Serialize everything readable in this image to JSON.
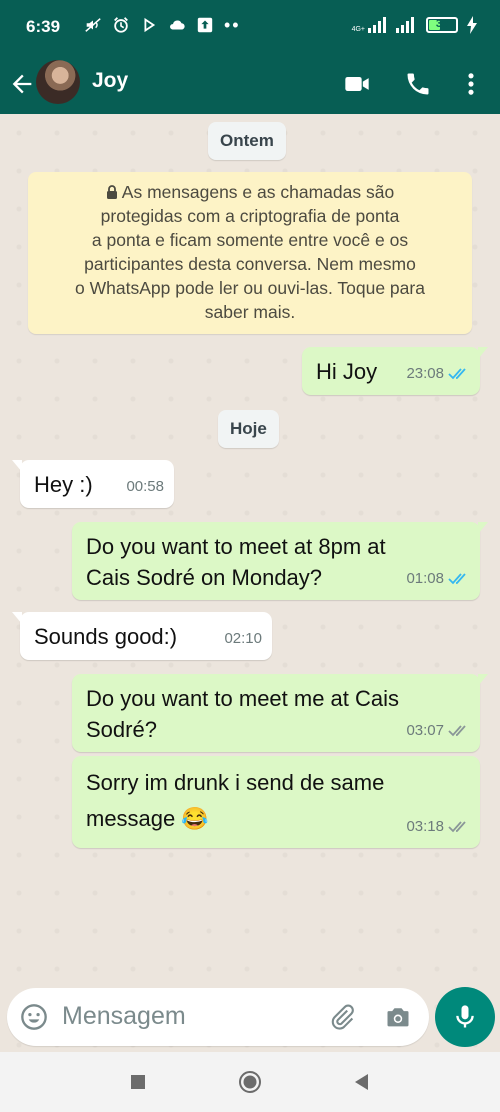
{
  "status_bar": {
    "time": "6:39",
    "battery": "39",
    "network": "4G+"
  },
  "header": {
    "contact_name": "Joy"
  },
  "chat": {
    "date_yesterday": "Ontem",
    "encryption_notice": "As mensagens e as chamadas são protegidas com a criptografia de ponta a ponta e ficam somente entre você e os participantes desta conversa. Nem mesmo o WhatsApp pode ler ou ouvi-las. Toque para saber mais.",
    "notice_lines": [
      "As mensagens e as chamadas são",
      "protegidas com a criptografia de ponta",
      "a ponta e ficam somente entre você e os",
      "participantes desta conversa. Nem mesmo",
      "o WhatsApp pode ler ou ouvi-las. Toque para",
      "saber mais."
    ],
    "date_today": "Hoje",
    "messages": [
      {
        "direction": "out",
        "lines": [
          "Hi Joy"
        ],
        "time": "23:08",
        "status": "read"
      },
      {
        "direction": "in",
        "lines": [
          "Hey :)"
        ],
        "time": "00:58"
      },
      {
        "direction": "out",
        "lines": [
          "Do you want to meet at 8pm at",
          "Cais Sodré on Monday?"
        ],
        "time": "01:08",
        "status": "read"
      },
      {
        "direction": "in",
        "lines": [
          "Sounds good:)"
        ],
        "time": "02:10"
      },
      {
        "direction": "out",
        "lines": [
          "Do you want to meet me at Cais",
          "Sodré?"
        ],
        "time": "03:07",
        "status": "delivered"
      },
      {
        "direction": "out",
        "lines": [
          "Sorry im drunk i send de same",
          "message 😂"
        ],
        "time": "03:18",
        "status": "delivered"
      }
    ]
  },
  "composer": {
    "placeholder": "Mensagem"
  },
  "colors": {
    "header": "#075e54",
    "outgoing_bubble": "#dcf8c6",
    "incoming_bubble": "#ffffff",
    "read_ticks": "#34b7f1",
    "delivered_ticks": "#8a9698",
    "mic_button": "#00897b"
  },
  "icons": {
    "status_left": [
      "mute-icon",
      "alarm-icon",
      "play-icon",
      "cloud-icon",
      "upload-icon"
    ],
    "status_right": [
      "signal-icon",
      "signal-icon",
      "battery-icon",
      "charging-icon"
    ],
    "header": [
      "back-arrow-icon",
      "video-call-icon",
      "phone-icon",
      "more-vert-icon"
    ],
    "composer": [
      "emoji-icon",
      "attach-icon",
      "camera-icon",
      "mic-icon"
    ],
    "nav": [
      "recents-icon",
      "home-icon",
      "back-icon"
    ]
  }
}
